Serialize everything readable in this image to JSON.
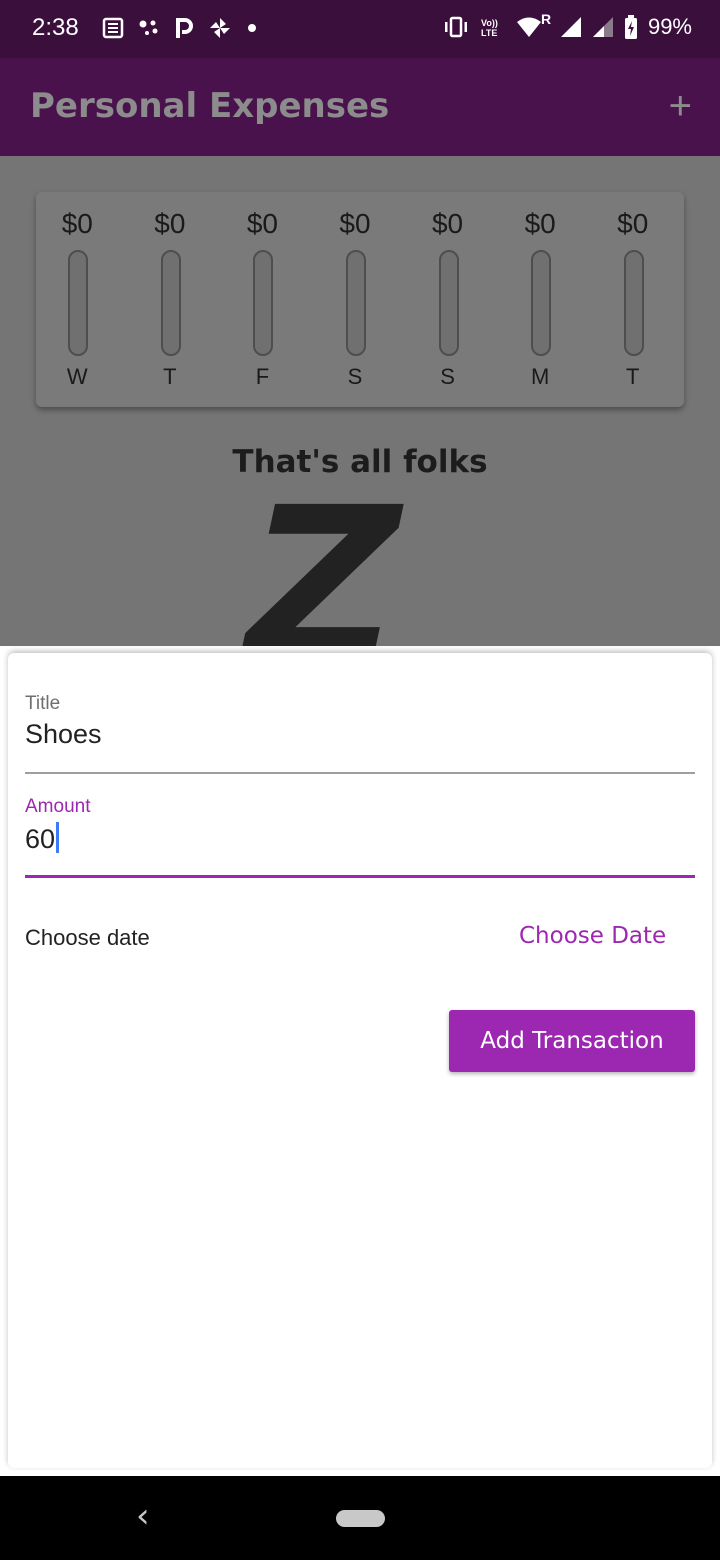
{
  "status_bar": {
    "time": "2:38",
    "battery": "99%",
    "network_badge": "R",
    "icons_left": [
      "news-icon",
      "dots-icon",
      "p-icon",
      "pinwheel-icon",
      "dot-icon"
    ],
    "icons_right": [
      "vibrate-icon",
      "volte-icon",
      "wifi-icon",
      "signal-icon",
      "signal-icon",
      "battery-icon"
    ]
  },
  "app_bar": {
    "title": "Personal Expenses",
    "add_icon": "plus-icon",
    "add_symbol": "+"
  },
  "chart": {
    "bars": [
      {
        "day": "W",
        "amount": "$0",
        "fill": 0
      },
      {
        "day": "T",
        "amount": "$0",
        "fill": 0
      },
      {
        "day": "F",
        "amount": "$0",
        "fill": 0
      },
      {
        "day": "S",
        "amount": "$0",
        "fill": 0
      },
      {
        "day": "S",
        "amount": "$0",
        "fill": 0
      },
      {
        "day": "M",
        "amount": "$0",
        "fill": 0
      },
      {
        "day": "T",
        "amount": "$0",
        "fill": 0
      }
    ]
  },
  "empty_state": {
    "text": "That's all folks",
    "image_glyph": "Z"
  },
  "form": {
    "title_label": "Title",
    "title_value": "Shoes",
    "amount_label": "Amount",
    "amount_value": "60",
    "date_text": "Choose date",
    "date_button": "Choose Date",
    "submit_button": "Add Transaction",
    "accent_color": "#9c27b0"
  },
  "nav_bar": {
    "back_symbol": "‹"
  }
}
